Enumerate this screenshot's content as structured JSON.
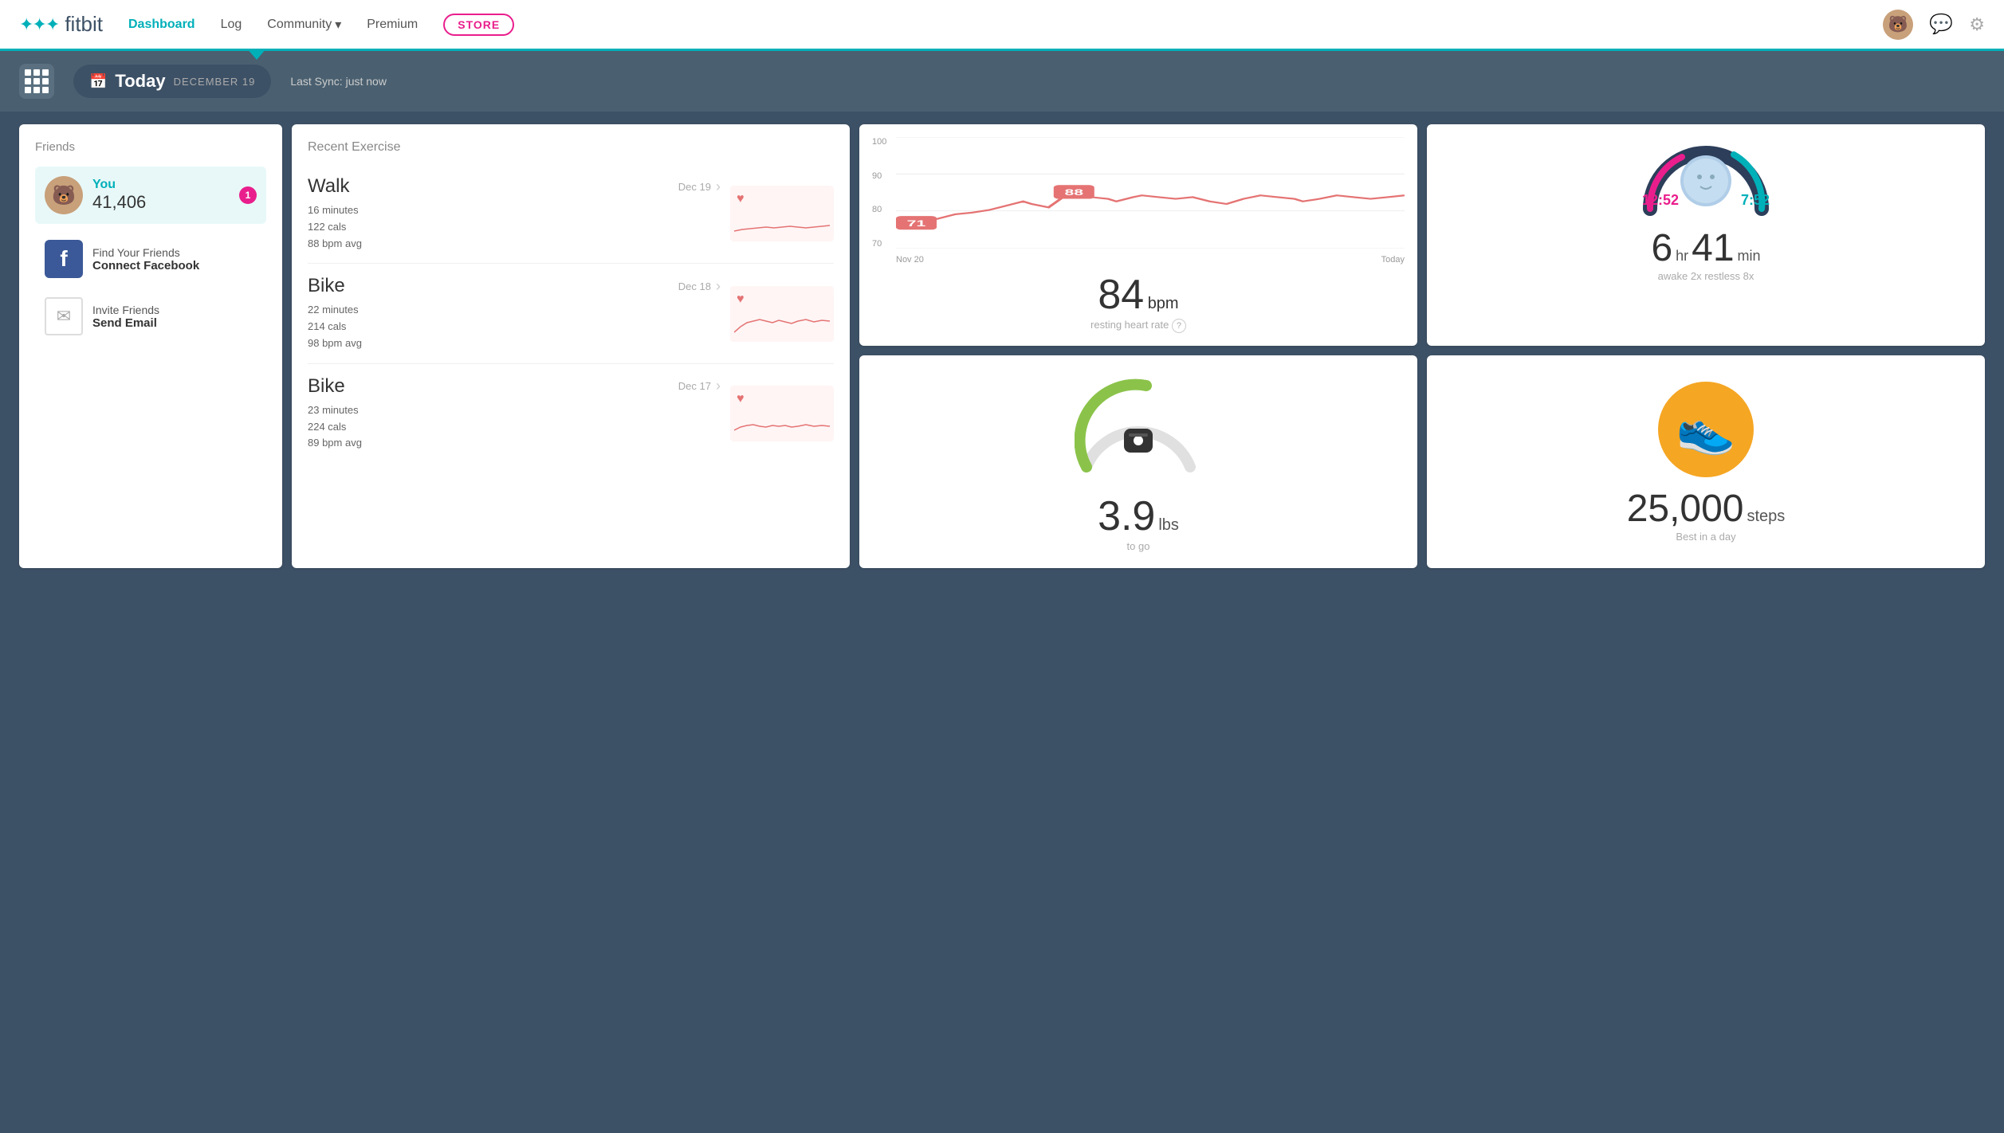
{
  "app": {
    "title": "fitbit",
    "logo_dots": "⁚⁚⁚"
  },
  "nav": {
    "dashboard_label": "Dashboard",
    "log_label": "Log",
    "community_label": "Community",
    "premium_label": "Premium",
    "store_label": "STORE"
  },
  "subheader": {
    "today_label": "Today",
    "date_label": "DECEMBER 19",
    "sync_text": "Last Sync: just now"
  },
  "friends": {
    "title": "Friends",
    "you_label": "You",
    "you_steps": "41,406",
    "you_badge": "1",
    "facebook_line1": "Find Your Friends",
    "facebook_line2": "Connect Facebook",
    "email_line1": "Invite Friends",
    "email_line2": "Send Email"
  },
  "exercise": {
    "title": "Recent Exercise",
    "items": [
      {
        "name": "Walk",
        "date": "Dec 19",
        "minutes": "16 minutes",
        "cals": "122 cals",
        "bpm": "88 bpm avg"
      },
      {
        "name": "Bike",
        "date": "Dec 18",
        "minutes": "22 minutes",
        "cals": "214 cals",
        "bpm": "98 bpm avg"
      },
      {
        "name": "Bike",
        "date": "Dec 17",
        "minutes": "23 minutes",
        "cals": "224 cals",
        "bpm": "89 bpm avg"
      }
    ]
  },
  "heartrate": {
    "y_labels": [
      "100",
      "90",
      "80",
      "70"
    ],
    "x_labels": [
      "Nov 20",
      "Today"
    ],
    "min_label": "71",
    "max_label": "88",
    "big_number": "84",
    "unit": "bpm",
    "label": "resting heart rate"
  },
  "sleep": {
    "time_start": "12:52",
    "time_end": "7:52",
    "hours": "6",
    "hr_label": "hr",
    "minutes": "41",
    "min_label": "min",
    "sub": "awake 2x   restless 8x"
  },
  "weight": {
    "number": "3.9",
    "unit": "lbs",
    "label": "to go"
  },
  "steps": {
    "number": "25,000",
    "unit": "steps",
    "label": "Best in a day"
  }
}
